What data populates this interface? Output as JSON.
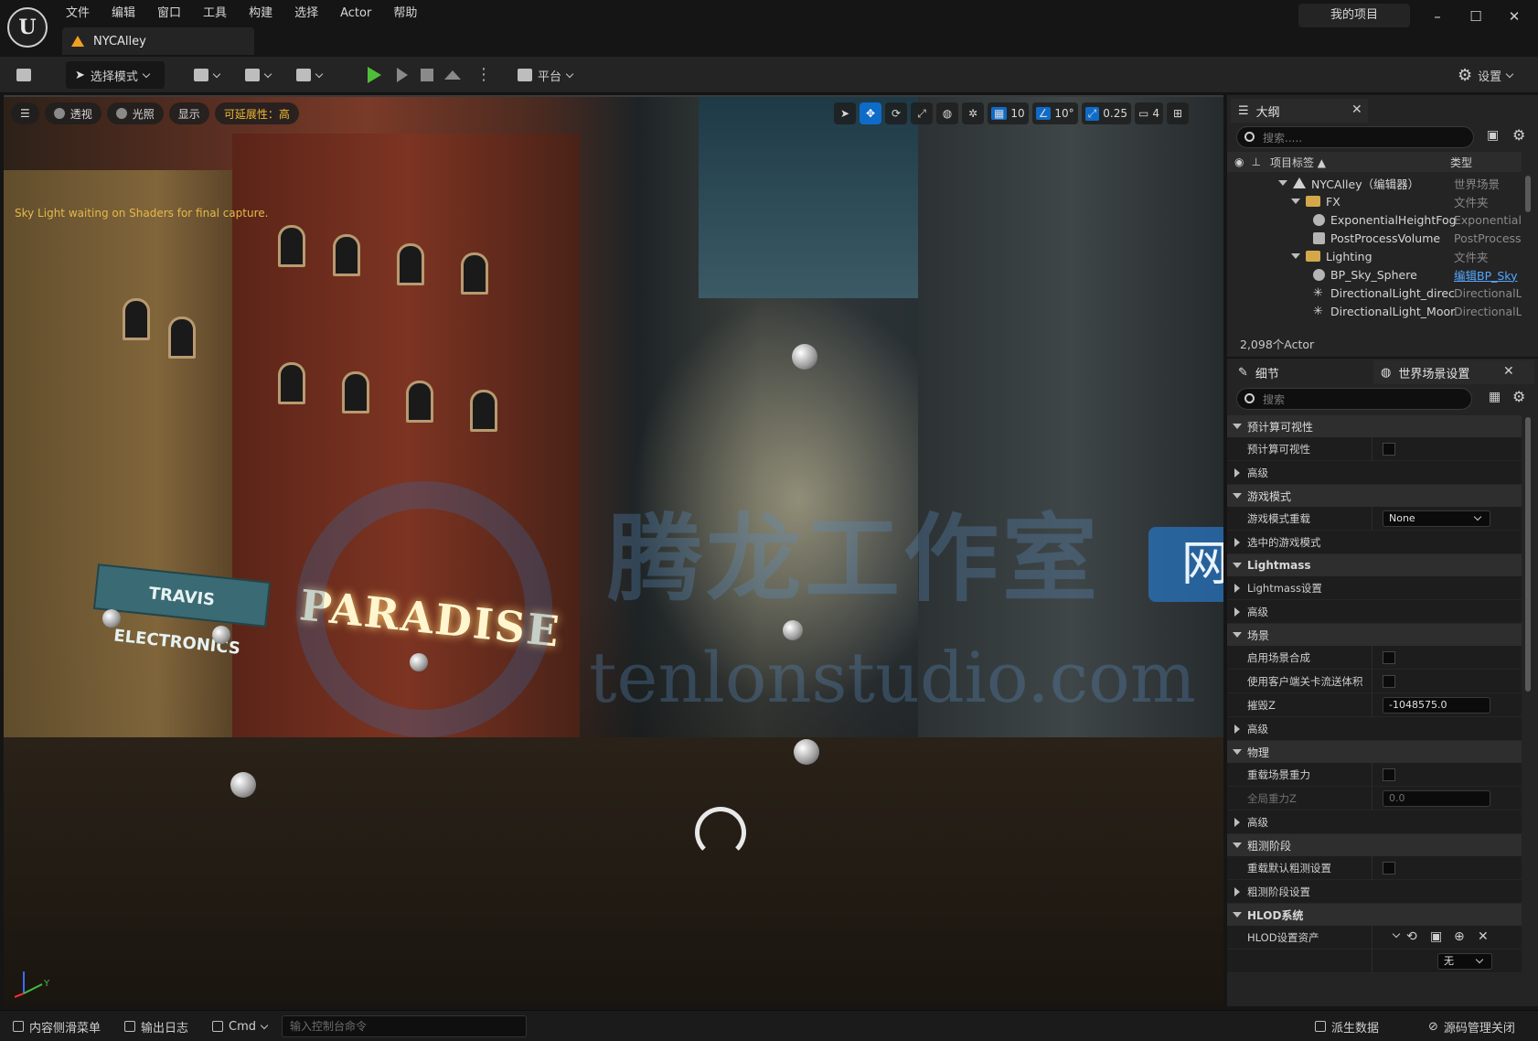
{
  "app": {
    "logo_text": "U",
    "level_tab": "NYCAlley",
    "project_name": "我的项目",
    "window_buttons": [
      "–",
      "☐",
      "✕"
    ]
  },
  "menu": [
    "文件",
    "编辑",
    "窗口",
    "工具",
    "构建",
    "选择",
    "Actor",
    "帮助"
  ],
  "toolbar": {
    "select_mode": "选择模式",
    "platform": "平台",
    "settings": "设置"
  },
  "viewport": {
    "perspective": "透视",
    "lit": "光照",
    "show": "显示",
    "scalability": "可延展性：高",
    "sky_light_warning": "Sky Light waiting on Shaders for final capture.",
    "grid_snap": "10",
    "angle_snap": "10°",
    "scale_snap": "0.25",
    "camera_speed": "4",
    "scene_signs": {
      "paradise": "PARADISE",
      "travis": "TRAVIS ELECTRONICS"
    },
    "watermark": {
      "text": "腾龙工作室",
      "box": "网站",
      "url": "tenlonstudio.com"
    },
    "axis_labels": {
      "y": "Y"
    }
  },
  "outliner": {
    "title": "大纲",
    "search_placeholder": "搜索.....",
    "col_label": "项目标签 ▲",
    "col_type": "类型",
    "rows": [
      {
        "label": "NYCAlley（编辑器）",
        "type": "世界场景"
      },
      {
        "label": "FX",
        "type": "文件夹"
      },
      {
        "label": "ExponentialHeightFog",
        "type": "ExponentialH"
      },
      {
        "label": "PostProcessVolume",
        "type": "PostProcess"
      },
      {
        "label": "Lighting",
        "type": "文件夹"
      },
      {
        "label": "BP_Sky_Sphere",
        "type": "编辑BP_Sky"
      },
      {
        "label": "DirectionalLight_direc",
        "type": "DirectionalL"
      },
      {
        "label": "DirectionalLight_Moor",
        "type": "DirectionalL"
      }
    ],
    "actor_count": "2,098个Actor"
  },
  "details": {
    "tab_details": "细节",
    "tab_world": "世界场景设置",
    "search_placeholder": "搜索",
    "sections": {
      "precomputed": "预计算可视性",
      "gamemode": "游戏模式",
      "lightmass": "Lightmass",
      "world": "场景",
      "physics": "物理",
      "broadphase": "粗测阶段",
      "hlod": "HLOD系统"
    },
    "props": {
      "precomputed_vis": "预计算可视性",
      "advanced": "高级",
      "gamemode_override": "游戏模式重载",
      "gamemode_override_value": "None",
      "selected_gamemode": "选中的游戏模式",
      "lightmass_settings": "Lightmass设置",
      "world_comp": "启用场景合成",
      "client_streaming": "使用客户端关卡流送体积",
      "kill_z": "摧毁Z",
      "kill_z_value": "-1048575.0",
      "override_gravity": "重载场景重力",
      "global_gravity": "全局重力Z",
      "global_gravity_value": "0.0",
      "override_broadphase": "重载默认粗测设置",
      "broadphase_settings": "粗测阶段设置",
      "hlod_asset": "HLOD设置资产",
      "none": "无"
    }
  },
  "statusbar": {
    "content_drawer": "内容侧滑菜单",
    "output_log": "输出日志",
    "cmd": "Cmd",
    "console_placeholder": "输入控制台命令",
    "derived_data": "派生数据",
    "source_control": "源码管理关闭"
  }
}
